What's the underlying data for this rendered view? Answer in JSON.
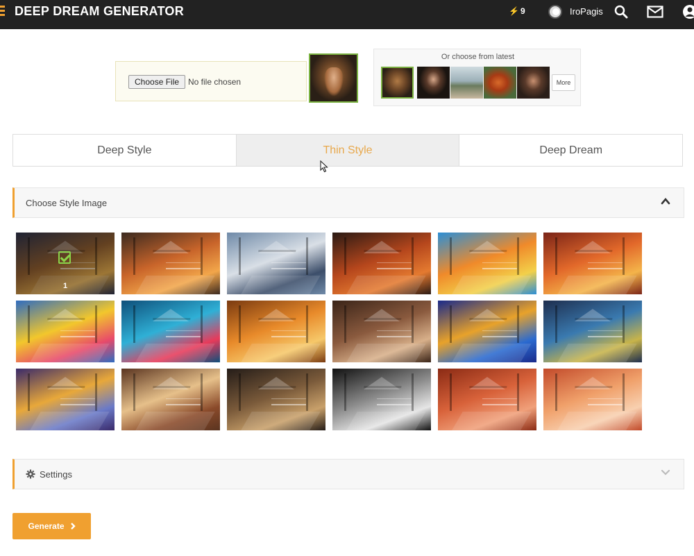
{
  "header": {
    "brand": "DEEP DREAM GENERATOR",
    "energy": "9",
    "username": "IroPagis",
    "icons": [
      "lightning-icon",
      "avatar",
      "search-icon",
      "mail-icon",
      "user-icon"
    ]
  },
  "upload": {
    "choose_file_label": "Choose File",
    "no_file_text": "No file chosen"
  },
  "latest": {
    "title": "Or choose from latest",
    "more_label": "More",
    "thumbs": [
      "dog",
      "man-with-beard",
      "child-by-lake",
      "chicken",
      "man-with-hair"
    ]
  },
  "tabs": [
    {
      "label": "Deep Style",
      "active": false
    },
    {
      "label": "Thin Style",
      "active": true
    },
    {
      "label": "Deep Dream",
      "active": false
    }
  ],
  "style_panel": {
    "title": "Choose Style Image",
    "selected_number": "1",
    "styles": [
      {
        "c1": "#2c3148",
        "c2": "#8a5a2e",
        "c3": "#d9a44a"
      },
      {
        "c1": "#3b2a20",
        "c2": "#c8642a",
        "c3": "#f2a64a"
      },
      {
        "c1": "#6f8aa8",
        "c2": "#d9dfe6",
        "c3": "#3c4e6a"
      },
      {
        "c1": "#2a1a14",
        "c2": "#b5461c",
        "c3": "#e47a30"
      },
      {
        "c1": "#2c8fd6",
        "c2": "#f08a2a",
        "c3": "#f2d04a"
      },
      {
        "c1": "#7a2418",
        "c2": "#e2682a",
        "c3": "#f4b44a"
      },
      {
        "c1": "#2f6cc0",
        "c2": "#f2c72c",
        "c3": "#e84a6a"
      },
      {
        "c1": "#0f4f7a",
        "c2": "#2fb0d6",
        "c3": "#e83a5a"
      },
      {
        "c1": "#7a3a10",
        "c2": "#e88a2a",
        "c3": "#f6c86a"
      },
      {
        "c1": "#3a2418",
        "c2": "#8a5a3e",
        "c3": "#d8b08a"
      },
      {
        "c1": "#1a2a8a",
        "c2": "#e8a22a",
        "c3": "#2a6ad0"
      },
      {
        "c1": "#1e2e4e",
        "c2": "#3a7ab0",
        "c3": "#c8b44a"
      },
      {
        "c1": "#3a2a6a",
        "c2": "#e8a83a",
        "c3": "#6a7ac8"
      },
      {
        "c1": "#5a3420",
        "c2": "#e6c08a",
        "c3": "#8a4a2a"
      },
      {
        "c1": "#241c18",
        "c2": "#7a5a3a",
        "c3": "#c8a06a"
      },
      {
        "c1": "#111111",
        "c2": "#8a8a8a",
        "c3": "#e6e6e6"
      },
      {
        "c1": "#8a2a14",
        "c2": "#d8623a",
        "c3": "#f0a07a"
      },
      {
        "c1": "#c24a2a",
        "c2": "#f0a06a",
        "c3": "#f8d0b0"
      }
    ]
  },
  "settings_panel": {
    "title": "Settings"
  },
  "actions": {
    "generate_label": "Generate"
  }
}
